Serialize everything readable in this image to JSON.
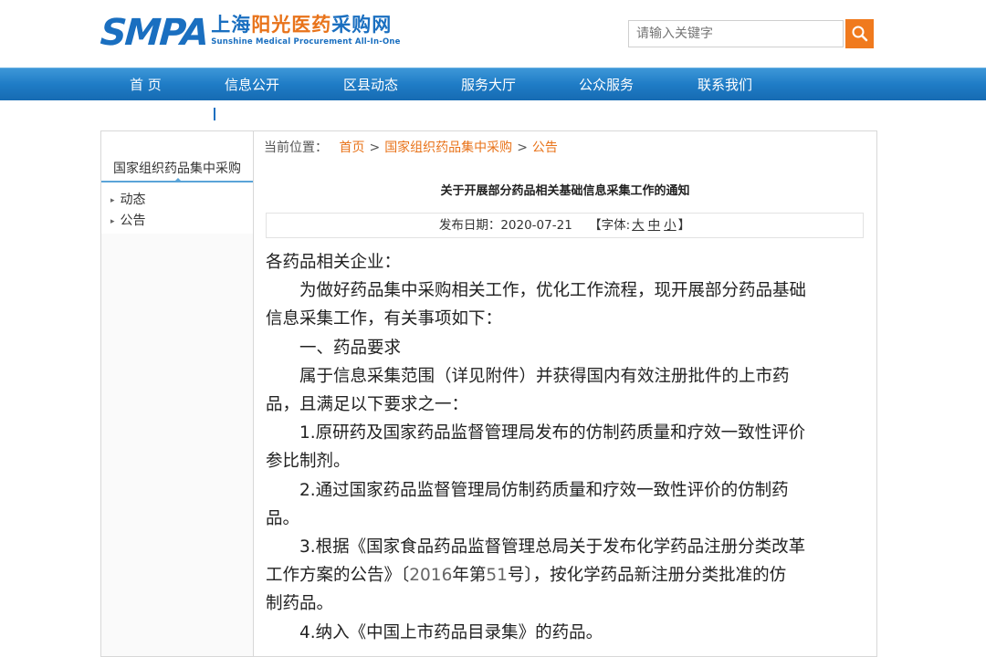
{
  "header": {
    "logo_smpa": "SMPA",
    "logo_cn_a": "上海",
    "logo_cn_b": "阳光医药",
    "logo_cn_c": "采购网",
    "logo_en": "Sunshine Medical Procurement All-In-One",
    "search_placeholder": "请输入关键字",
    "search_icon": "search-icon"
  },
  "nav": {
    "items": [
      "首 页",
      "信息公开",
      "区县动态",
      "服务大厅",
      "公众服务",
      "联系我们"
    ]
  },
  "sidebar": {
    "title": "国家组织药品集中采购",
    "items": [
      "动态",
      "公告"
    ]
  },
  "breadcrumb": {
    "prefix": "当前位置：",
    "home": "首页",
    "sep": ">",
    "level1": "国家组织药品集中采购",
    "level2": "公告"
  },
  "article": {
    "title": "关于开展部分药品相关基础信息采集工作的通知",
    "date_label": "发布日期：",
    "date": "2020-07-21",
    "font_label": "【字体:",
    "font_large": "大",
    "font_medium": "中",
    "font_small": "小",
    "font_close": "】",
    "lines": {
      "l1": "各药品相关企业：",
      "l2": "为做好药品集中采购相关工作，优化工作流程，现开展部分药品基础",
      "l3": "信息采集工作，有关事项如下：",
      "l4": "一、药品要求",
      "l5": "属于信息采集范围（详见附件）并获得国内有效注册批件的上市药",
      "l6": "品，且满足以下要求之一：",
      "l7": "1.原研药及国家药品监督管理局发布的仿制药质量和疗效一致性评价",
      "l8": "参比制剂。",
      "l9": "2.通过国家药品监督管理局仿制药质量和疗效一致性评价的仿制药",
      "l10": "品。",
      "l11": "3.根据《国家食品药品监督管理总局关于发布化学药品注册分类改革",
      "l12a": "工作方案的公告》〔",
      "l12b": "2016",
      "l12c": "年第",
      "l12d": "51",
      "l12e": "号〕，按化学药品新注册分类批准的仿",
      "l13": "制药品。",
      "l14": "4.纳入《中国上市药品目录集》的药品。"
    }
  },
  "colors": {
    "brand_blue": "#1a6fc0",
    "accent_orange": "#e8731a",
    "nav_blue": "#1f7cc6"
  }
}
